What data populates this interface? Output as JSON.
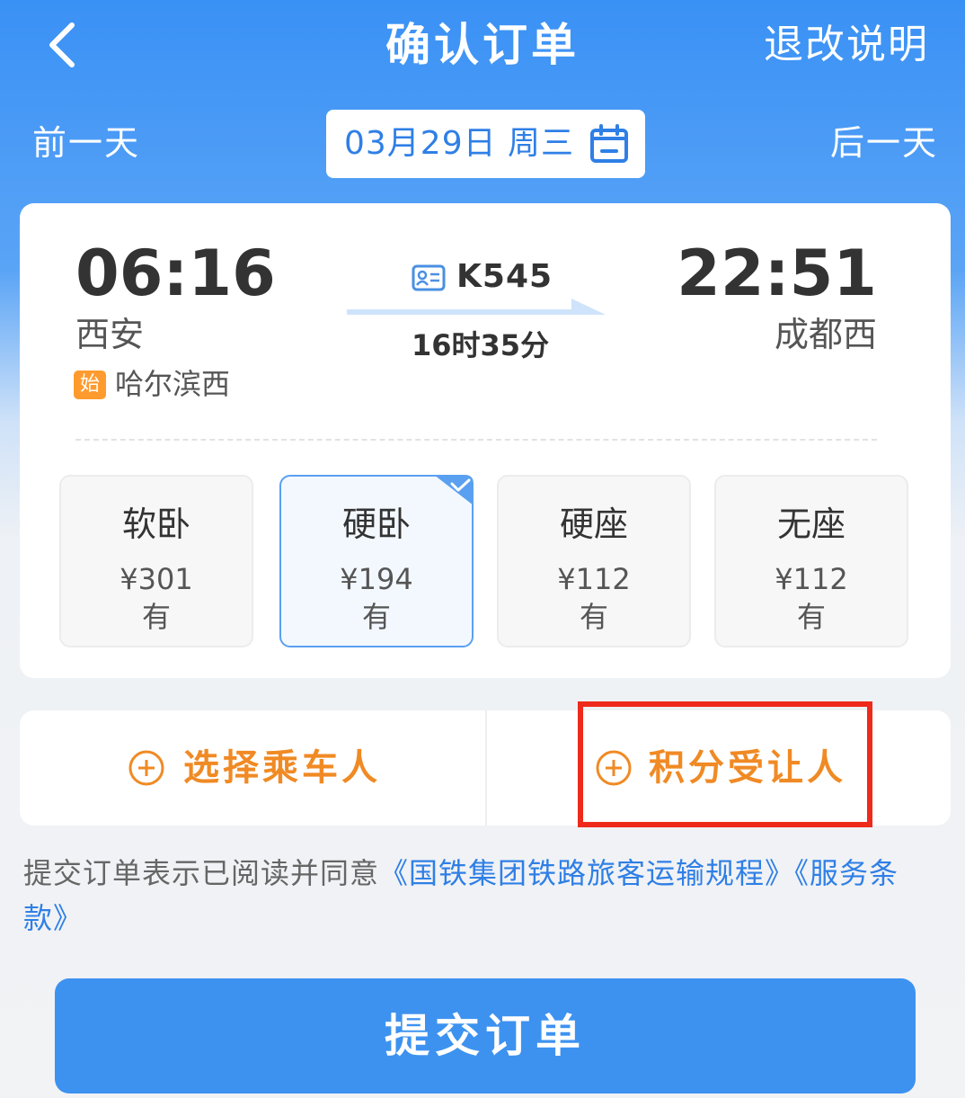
{
  "header": {
    "title": "确认订单",
    "refund_link": "退改说明",
    "prev_day": "前一天",
    "next_day": "后一天",
    "date": "03月29日 周三"
  },
  "train": {
    "departure_time": "06:16",
    "departure_station": "西安",
    "origin_badge": "始",
    "origin_station": "哈尔滨西",
    "train_number": "K545",
    "duration": "16时35分",
    "arrival_time": "22:51",
    "arrival_station": "成都西"
  },
  "seats": [
    {
      "name": "软卧",
      "price": "¥301",
      "availability": "有",
      "selected": false
    },
    {
      "name": "硬卧",
      "price": "¥194",
      "availability": "有",
      "selected": true
    },
    {
      "name": "硬座",
      "price": "¥112",
      "availability": "有",
      "selected": false
    },
    {
      "name": "无座",
      "price": "¥112",
      "availability": "有",
      "selected": false
    }
  ],
  "actions": {
    "select_passenger": "选择乘车人",
    "points_recipient": "积分受让人"
  },
  "terms": {
    "prefix": "提交订单表示已阅读并同意",
    "link1": "《国铁集团铁路旅客运输规程》",
    "link2": "《服务条款》"
  },
  "submit_label": "提交订单",
  "colors": {
    "primary": "#3d92f0",
    "accent_orange": "#f08a24",
    "highlight_red": "#ee2a1b"
  }
}
